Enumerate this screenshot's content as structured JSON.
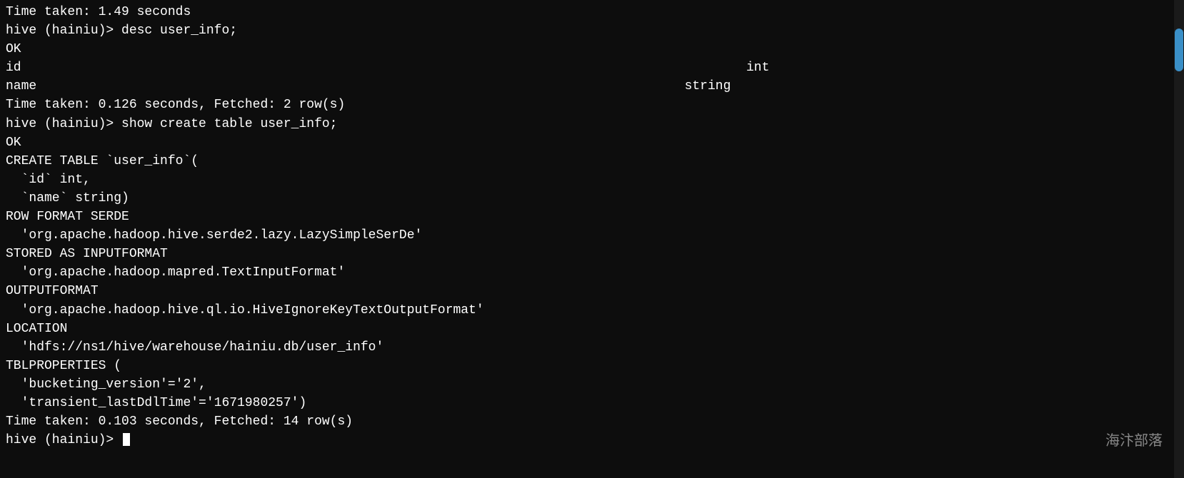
{
  "terminal": {
    "lines": [
      {
        "id": "line1",
        "text": "Time taken: 1.49 seconds",
        "color": "white"
      },
      {
        "id": "line2",
        "text": "hive (hainiu)> desc user_info;",
        "color": "white"
      },
      {
        "id": "line3",
        "text": "OK",
        "color": "white"
      },
      {
        "id": "line4",
        "text": "id                      \t\t\t\tint",
        "color": "white"
      },
      {
        "id": "line5",
        "text": "name                    \t\t\t\tstring",
        "color": "white"
      },
      {
        "id": "line6",
        "text": "Time taken: 0.126 seconds, Fetched: 2 row(s)",
        "color": "white"
      },
      {
        "id": "line7",
        "text": "hive (hainiu)> show create table user_info;",
        "color": "white"
      },
      {
        "id": "line8",
        "text": "OK",
        "color": "white"
      },
      {
        "id": "line9",
        "text": "CREATE TABLE `user_info`(",
        "color": "white"
      },
      {
        "id": "line10",
        "text": "  `id` int,",
        "color": "white"
      },
      {
        "id": "line11",
        "text": "  `name` string)",
        "color": "white"
      },
      {
        "id": "line12",
        "text": "ROW FORMAT SERDE",
        "color": "white"
      },
      {
        "id": "line13",
        "text": "  'org.apache.hadoop.hive.serde2.lazy.LazySimpleSerDe'",
        "color": "white"
      },
      {
        "id": "line14",
        "text": "STORED AS INPUTFORMAT",
        "color": "white"
      },
      {
        "id": "line15",
        "text": "  'org.apache.hadoop.mapred.TextInputFormat'",
        "color": "white"
      },
      {
        "id": "line16",
        "text": "OUTPUTFORMAT",
        "color": "white"
      },
      {
        "id": "line17",
        "text": "  'org.apache.hadoop.hive.ql.io.HiveIgnoreKeyTextOutputFormat'",
        "color": "white"
      },
      {
        "id": "line18",
        "text": "LOCATION",
        "color": "white"
      },
      {
        "id": "line19",
        "text": "  'hdfs://ns1/hive/warehouse/hainiu.db/user_info'",
        "color": "white"
      },
      {
        "id": "line20",
        "text": "TBLPROPERTIES (",
        "color": "white"
      },
      {
        "id": "line21",
        "text": "  'bucketing_version'='2',",
        "color": "white"
      },
      {
        "id": "line22",
        "text": "  'transient_lastDdlTime'='1671980257')",
        "color": "white"
      },
      {
        "id": "line23",
        "text": "Time taken: 0.103 seconds, Fetched: 14 row(s)",
        "color": "white"
      },
      {
        "id": "line24",
        "text": "hive (hainiu)> ",
        "color": "white",
        "cursor": true
      }
    ]
  },
  "watermark": "海汴部落",
  "scrollbar": {
    "visible": true
  }
}
